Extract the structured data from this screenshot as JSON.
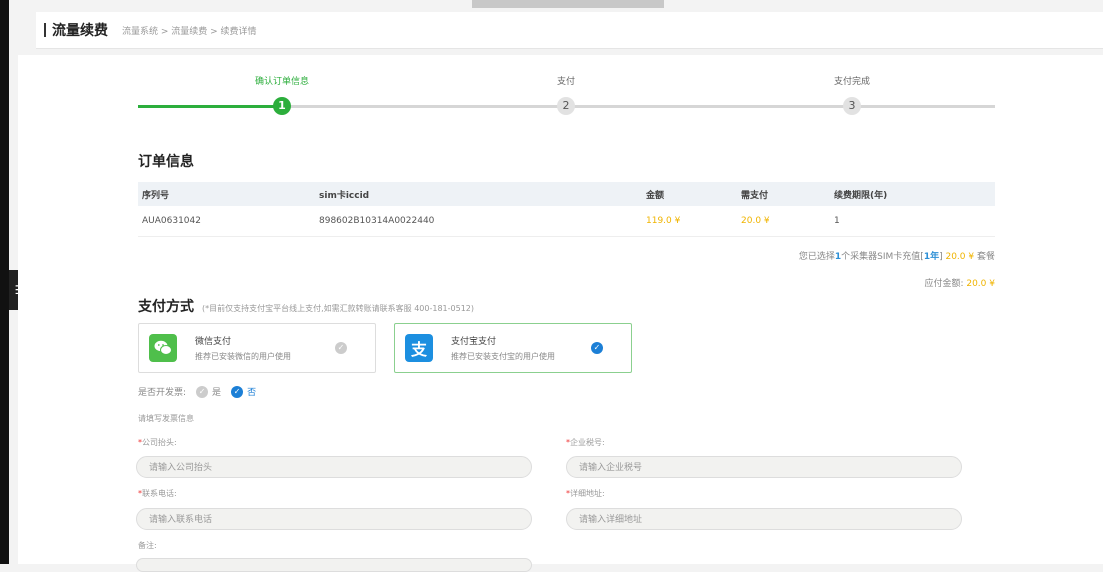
{
  "header": {
    "title": "流量续费",
    "breadcrumb": "流量系统 > 流量续费 > 续费详情"
  },
  "steps": [
    {
      "label": "确认订单信息",
      "num": "1",
      "active": true
    },
    {
      "label": "支付",
      "num": "2",
      "active": false
    },
    {
      "label": "支付完成",
      "num": "3",
      "active": false
    }
  ],
  "order": {
    "title": "订单信息",
    "columns": [
      "序列号",
      "sim卡iccid",
      "金额",
      "需支付",
      "续费期限(年)"
    ],
    "rows": [
      [
        "AUA0631042",
        "898602B10314A0022440",
        "119.0 ¥",
        "20.0 ¥",
        "1"
      ]
    ]
  },
  "summary": {
    "prefix": "您已选择",
    "count": "1",
    "middle": "个采集器SIM卡充值[",
    "period": "1年",
    "suffix1": "]",
    "price": "20.0 ¥",
    "suffix2": "套餐",
    "total_label": "应付金额:",
    "total_value": "20.0 ¥"
  },
  "payment": {
    "title": "支付方式",
    "note": "(*目前仅支持支付宝平台线上支付,如需汇款转账请联系客服 400-181-0512)",
    "options": [
      {
        "name": "微信支付",
        "desc": "推荐已安装微信的用户使用",
        "icon": "wechat-icon",
        "selected": false
      },
      {
        "name": "支付宝支付",
        "desc": "推荐已安装支付宝的用户使用",
        "icon": "alipay-icon",
        "selected": true
      }
    ]
  },
  "invoice": {
    "label": "是否开发票:",
    "yes": "是",
    "no": "否",
    "selected": "no",
    "hint": "请填写发票信息",
    "fields": {
      "company_label": "公司抬头",
      "company_placeholder": "请输入公司抬头",
      "tax_label": "企业税号",
      "tax_placeholder": "请输入企业税号",
      "phone_label": "联系电话",
      "phone_placeholder": "请输入联系电话",
      "address_label": "详细地址",
      "address_placeholder": "请输入详细地址",
      "remark_label": "备注"
    }
  },
  "colors": {
    "accent_green": "#2cae3c",
    "accent_blue": "#1c7fd6",
    "money_gold": "#f0b400"
  }
}
